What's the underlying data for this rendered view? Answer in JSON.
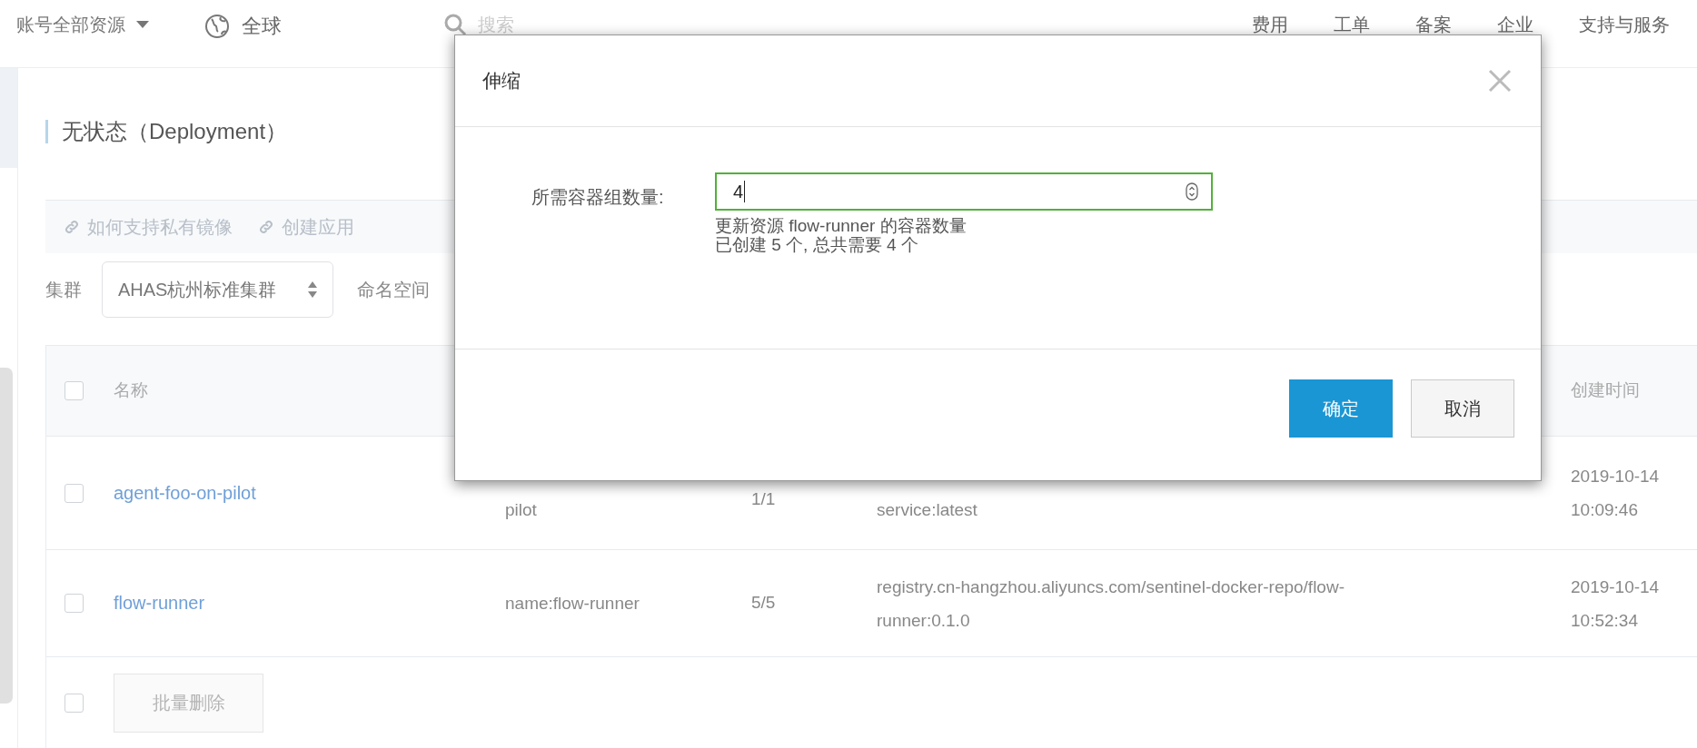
{
  "topbar": {
    "account_menu": "账号全部资源",
    "region": "全球",
    "search_placeholder": "搜索",
    "nav": [
      "费用",
      "工单",
      "备案",
      "企业",
      "支持与服务"
    ]
  },
  "page": {
    "title": "无状态（Deployment）",
    "links": [
      "如何支持私有镜像",
      "创建应用"
    ],
    "cluster_label": "集群",
    "cluster_value": "AHAS杭州标准集群",
    "namespace_label": "命名空间"
  },
  "table": {
    "header_checked": false,
    "columns": [
      {
        "label": "名称"
      },
      {
        "label": "创建时间"
      }
    ],
    "rows": [
      {
        "checked": false,
        "name": "agent-foo-on-pilot",
        "label_lines": [
          "pilot"
        ],
        "pods": "1/1",
        "image_lines": [
          "service:latest"
        ],
        "created_lines": [
          "2019-10-14",
          "10:09:46"
        ]
      },
      {
        "checked": false,
        "name": "flow-runner",
        "label_lines": [
          "name:flow-runner"
        ],
        "pods": "5/5",
        "image_lines": [
          "registry.cn-hangzhou.aliyuncs.com/sentinel-docker-repo/flow-",
          "runner:0.1.0"
        ],
        "created_lines": [
          "2019-10-14",
          "10:52:34"
        ]
      }
    ],
    "footer": {
      "checked": false,
      "button": "批量删除",
      "disabled": true
    }
  },
  "modal": {
    "title": "伸缩",
    "field_label": "所需容器组数量:",
    "value": "4",
    "focused": true,
    "help_lines": [
      "更新资源 flow-runner 的容器数量",
      "已创建 5 个, 总共需要 4 个"
    ],
    "buttons": [
      {
        "label": "确定",
        "kind": "primary"
      },
      {
        "label": "取消",
        "kind": "secondary"
      }
    ]
  }
}
